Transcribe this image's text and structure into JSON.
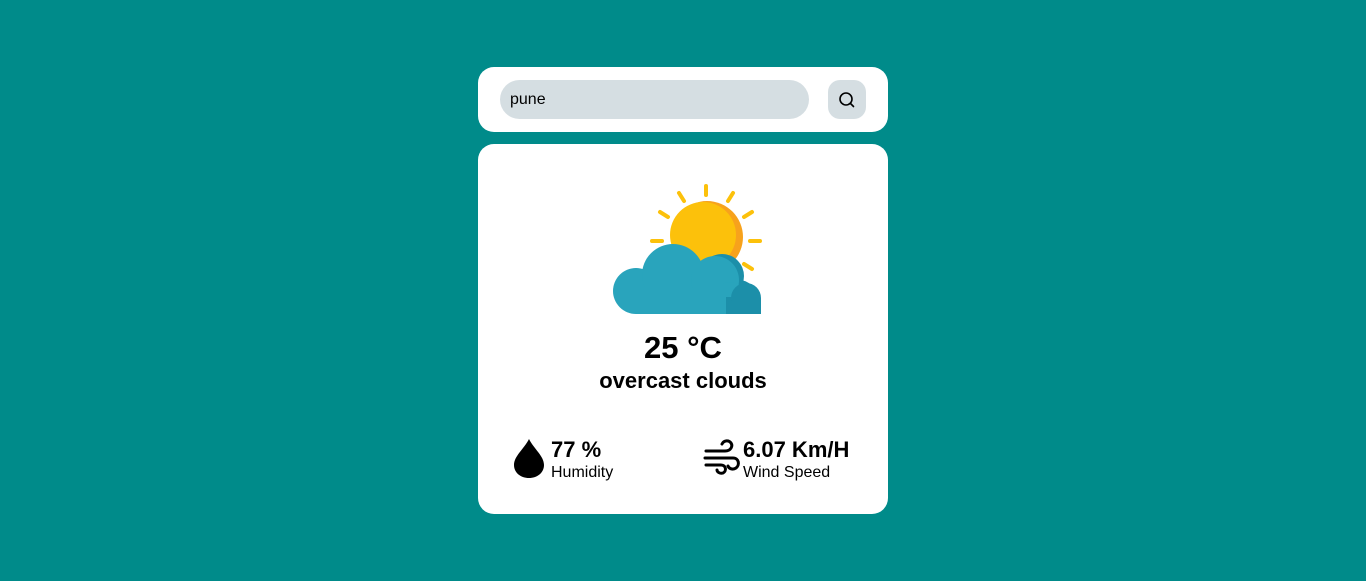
{
  "search": {
    "value": "pune",
    "icon": "search-icon"
  },
  "weather": {
    "icon": "partly-cloudy-sun-icon",
    "temperature": "25 °C",
    "condition": "overcast clouds"
  },
  "stats": {
    "humidity": {
      "icon": "water-drop-icon",
      "value": "77 %",
      "label": "Humidity"
    },
    "wind": {
      "icon": "wind-icon",
      "value": "6.07 Km/H",
      "label": "Wind Speed"
    }
  },
  "colors": {
    "background": "#008b8a",
    "card": "#ffffff",
    "input": "#d5dee2",
    "sun": "#fcc10b",
    "cloud": "#29a4bc"
  }
}
